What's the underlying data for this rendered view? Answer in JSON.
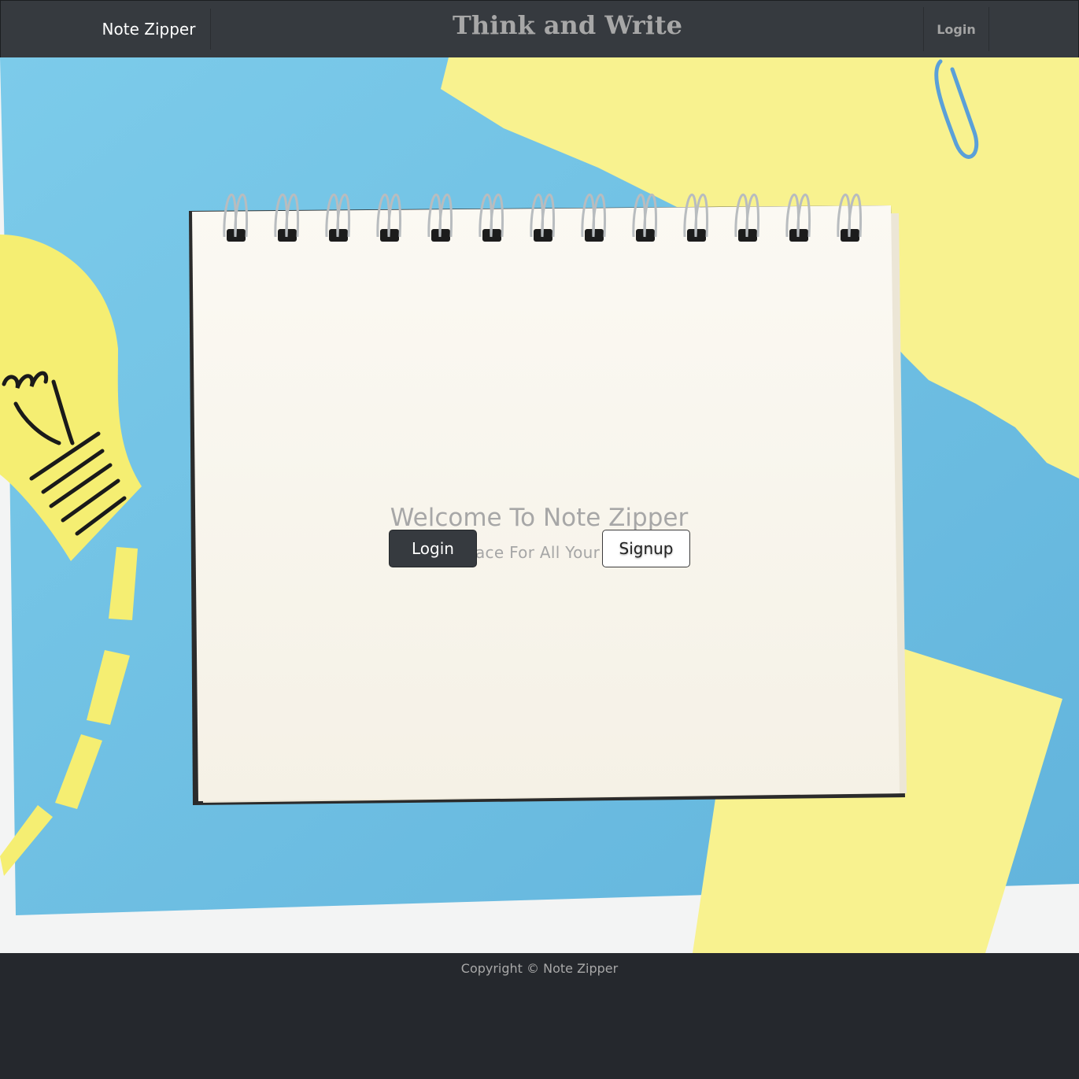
{
  "navbar": {
    "brand": "Note Zipper",
    "title": "Think and Write",
    "login_label": "Login"
  },
  "hero": {
    "illustration": "notebook-on-desk-background",
    "title": "Welcome To Note Zipper",
    "subtitle": "Safe Place For All Your Notes!",
    "login_button": "Login",
    "signup_button": "Signup"
  },
  "footer": {
    "copyright": "Copyright © Note Zipper"
  },
  "colors": {
    "navbar_bg": "#363a3f",
    "footer_bg": "#25282d",
    "blue_paper": "#6fbfe0",
    "yellow_paper": "#f8f28f",
    "notebook_page": "#f7f3ea"
  }
}
